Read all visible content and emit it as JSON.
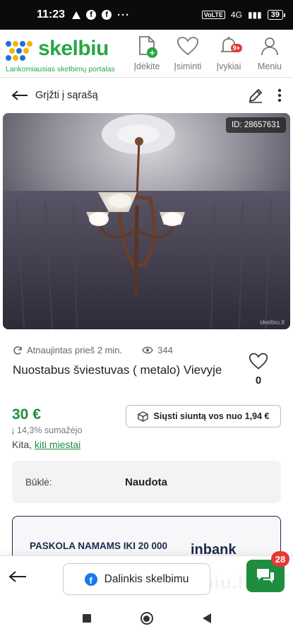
{
  "status": {
    "time": "11:23",
    "battery": "39",
    "network": "4G"
  },
  "header": {
    "logo_text": "skelbiu",
    "tagline": "Lankomiausias skelbimų portalas",
    "nav": [
      {
        "label": "Įdėkite",
        "icon": "add-document-icon"
      },
      {
        "label": "Įsiminti",
        "icon": "heart-icon"
      },
      {
        "label": "Įvykiai",
        "icon": "bell-icon",
        "badge": "9+"
      },
      {
        "label": "Meniu",
        "icon": "user-icon"
      }
    ]
  },
  "toolbar": {
    "back_label": "Grįžti į sąrašą"
  },
  "listing": {
    "id_label": "ID: 28657631",
    "watermark": "skelbiu.lt",
    "updated": "Atnaujintas prieš 2 min.",
    "views": "344",
    "title": "Nuostabus šviestuvas ( metalo) Vievyje",
    "favorites": "0",
    "price": "30 €",
    "price_drop": "14,3% sumažėjo",
    "location_prefix": "Kita,",
    "location_link": "kiti miestai",
    "ship_label": "Siųsti siuntą vos nuo 1,94 €",
    "condition_label": "Būklė:",
    "condition_value": "Naudota"
  },
  "ad": {
    "text": "PASKOLA NAMAMS IKI 20 000",
    "brand": "inbank"
  },
  "bottom": {
    "share_label": "Dalinkis skelbimu",
    "watermark": "skelbiu.lt",
    "chat_badge": "28"
  },
  "colors": {
    "brand_green": "#28a745",
    "price_green": "#1e8e3e",
    "badge_red": "#e53935"
  }
}
